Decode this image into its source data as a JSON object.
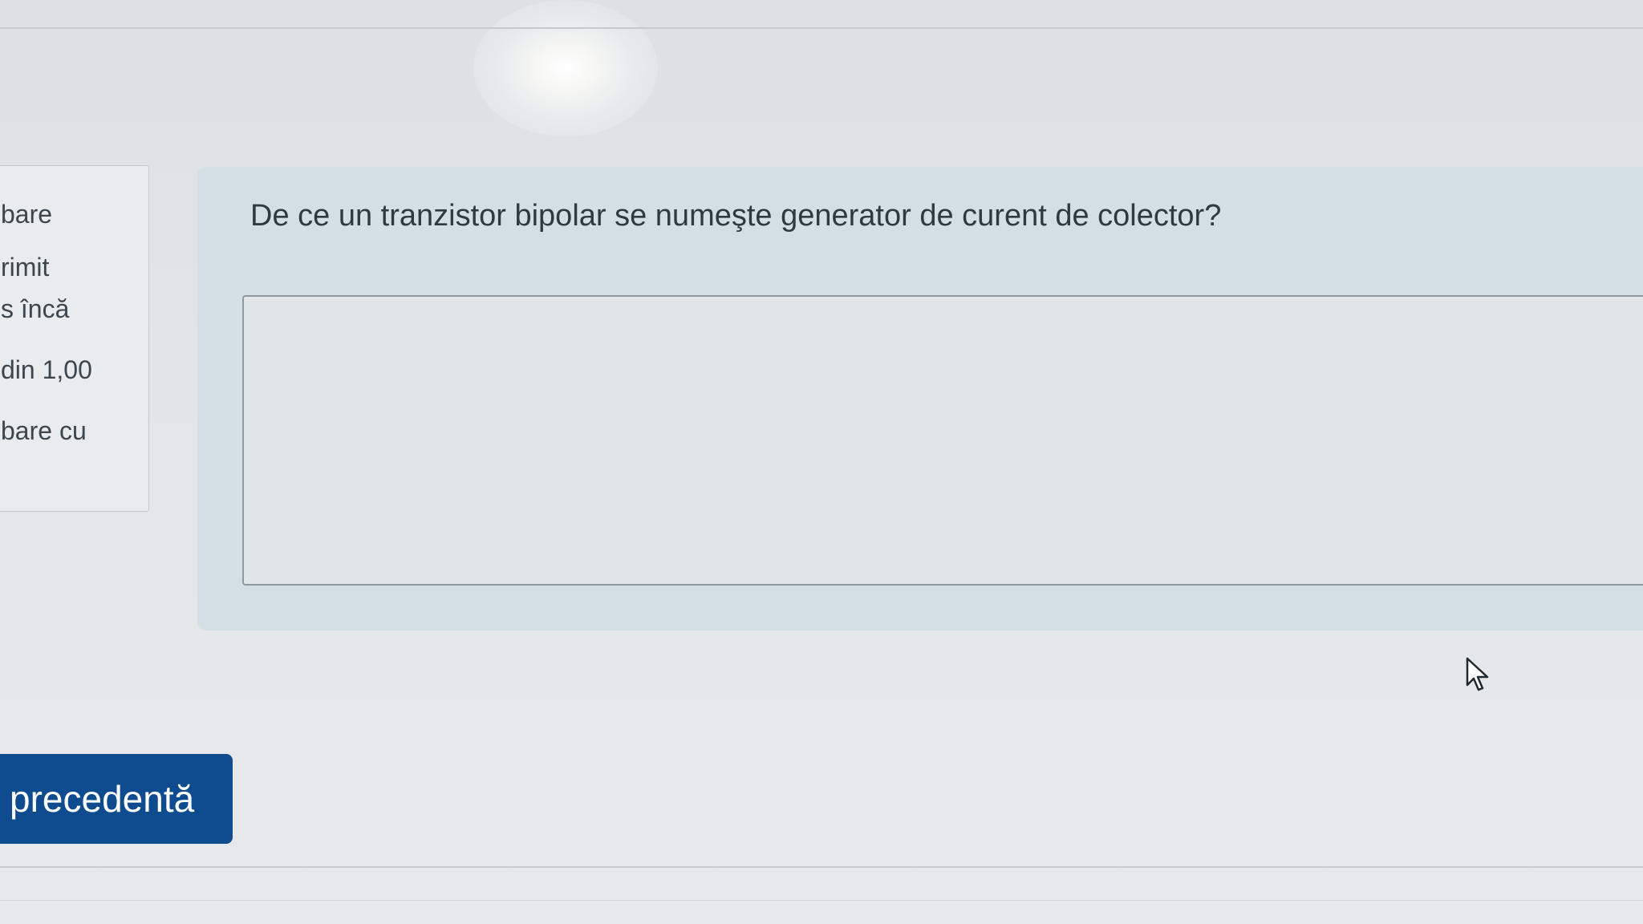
{
  "sidebar_info": {
    "lines": [
      "bare",
      "rimit",
      "s încă",
      "din 1,00",
      "bare cu"
    ]
  },
  "question": {
    "text": "De ce un tranzistor bipolar se numeşte generator de curent de colector?",
    "answer_value": ""
  },
  "navigation": {
    "previous_label": "precedentă"
  },
  "icons": {
    "cursor": "mouse-pointer-icon"
  },
  "colors": {
    "button_primary": "#0f4c8f",
    "question_panel_bg": "#d4dfe3"
  }
}
